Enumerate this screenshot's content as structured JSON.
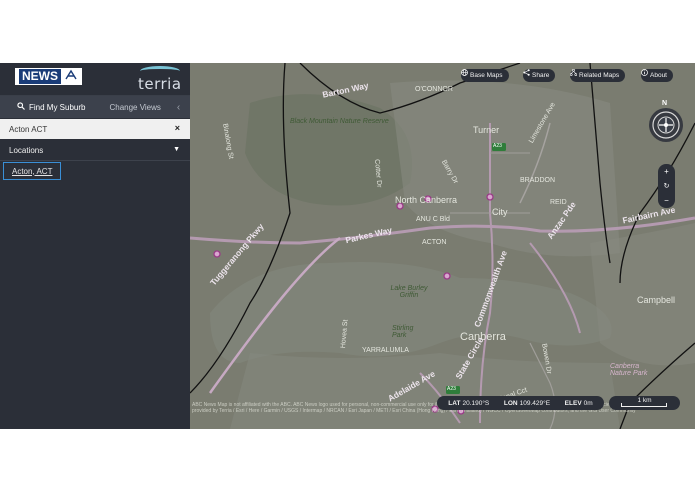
{
  "sidebar": {
    "news_logo_text": "NEWS",
    "news_logo_mark": "ABC",
    "terria_logo_text": "terria",
    "tabs": {
      "find_suburb": "Find My Suburb",
      "change_views": "Change Views",
      "back_glyph": "‹"
    },
    "search": {
      "value": "Acton ACT",
      "clear_glyph": "×"
    },
    "locations": {
      "heading": "Locations",
      "caret": "▼",
      "results": [
        "Acton, ACT"
      ]
    }
  },
  "map": {
    "toolbar": {
      "base_maps": "Base Maps",
      "share": "Share",
      "related_maps": "Related Maps",
      "about": "About"
    },
    "compass_north": "N",
    "zoom": {
      "in": "+",
      "reset": "↻",
      "out": "−"
    },
    "status": {
      "lat_label": "LAT",
      "lat_value": "20.190°S",
      "lon_label": "LON",
      "lon_value": "109.429°E",
      "elev_label": "ELEV",
      "elev_value": "0m"
    },
    "scale_label": "1 km",
    "attribution": "ABC News Map is not affiliated with the ABC. ABC News logo used for personal, non-commercial use only for illustration or private study analysis. Data Commonwealth of Australia (Geoscience Australia) / Mapping data provided by Terria / Esri / Here / Garmin / USGS / Intermap / NRCAN / Esri Japan / METI / Esri China (Hong Kong) / Esri (Thailand) / NGCC / OpenStreetMap contributors, and the GIS User Community",
    "labels": {
      "barton": "Barton Way",
      "oconnor": "O'CONNOR",
      "black_mountain": "Black Mountain Nature Reserve",
      "turner": "Turner",
      "north_canberra": "North Canberra",
      "city": "City",
      "acton": "ACTON",
      "parkes_way": "Parkes Way",
      "fairbairn": "Fairbairn Ave",
      "lake": "Lake Burley Griffin",
      "campbell": "Campbell",
      "tuggeranong": "Tuggeranong Pkwy",
      "canberra": "Canberra",
      "stirling": "Stirling Park",
      "yarralumla": "YARRALUMLA",
      "adelaide": "Adelaide Ave",
      "state_circle": "State Circle",
      "commonwealth": "Commonwealth Ave",
      "nature_park": "Canberra Nature Park",
      "binalong": "Binalong St",
      "anzac": "Anzac Pde",
      "limestone": "Limestone Ave",
      "bowen": "Bowen Dr",
      "reid": "REID",
      "braddon": "BRADDON",
      "uni": "ANU C Bld",
      "hovea": "Hovea St",
      "barry": "Barry Dr",
      "cotter": "Cotter Dr",
      "national_circuit": "National Cct",
      "badge_a23": "A23"
    }
  }
}
